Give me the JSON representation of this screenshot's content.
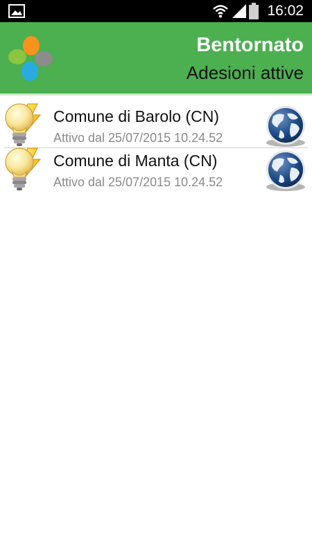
{
  "status_bar": {
    "time": "16:02",
    "icons": [
      "gallery-icon",
      "wifi-icon",
      "signal-icon",
      "battery-icon"
    ]
  },
  "header": {
    "title": "Bentornato",
    "subtitle": "Adesioni attive",
    "color": "#4caf50"
  },
  "items": [
    {
      "name": "Comune di Barolo (CN)",
      "status": "Attivo dal 25/07/2015 10.24.52",
      "left_icon": "lightbulb-icon",
      "right_icon": "globe-icon"
    },
    {
      "name": "Comune di Manta (CN)",
      "status": "Attivo dal 25/07/2015 10.24.52",
      "left_icon": "lightbulb-icon",
      "right_icon": "globe-icon"
    }
  ]
}
